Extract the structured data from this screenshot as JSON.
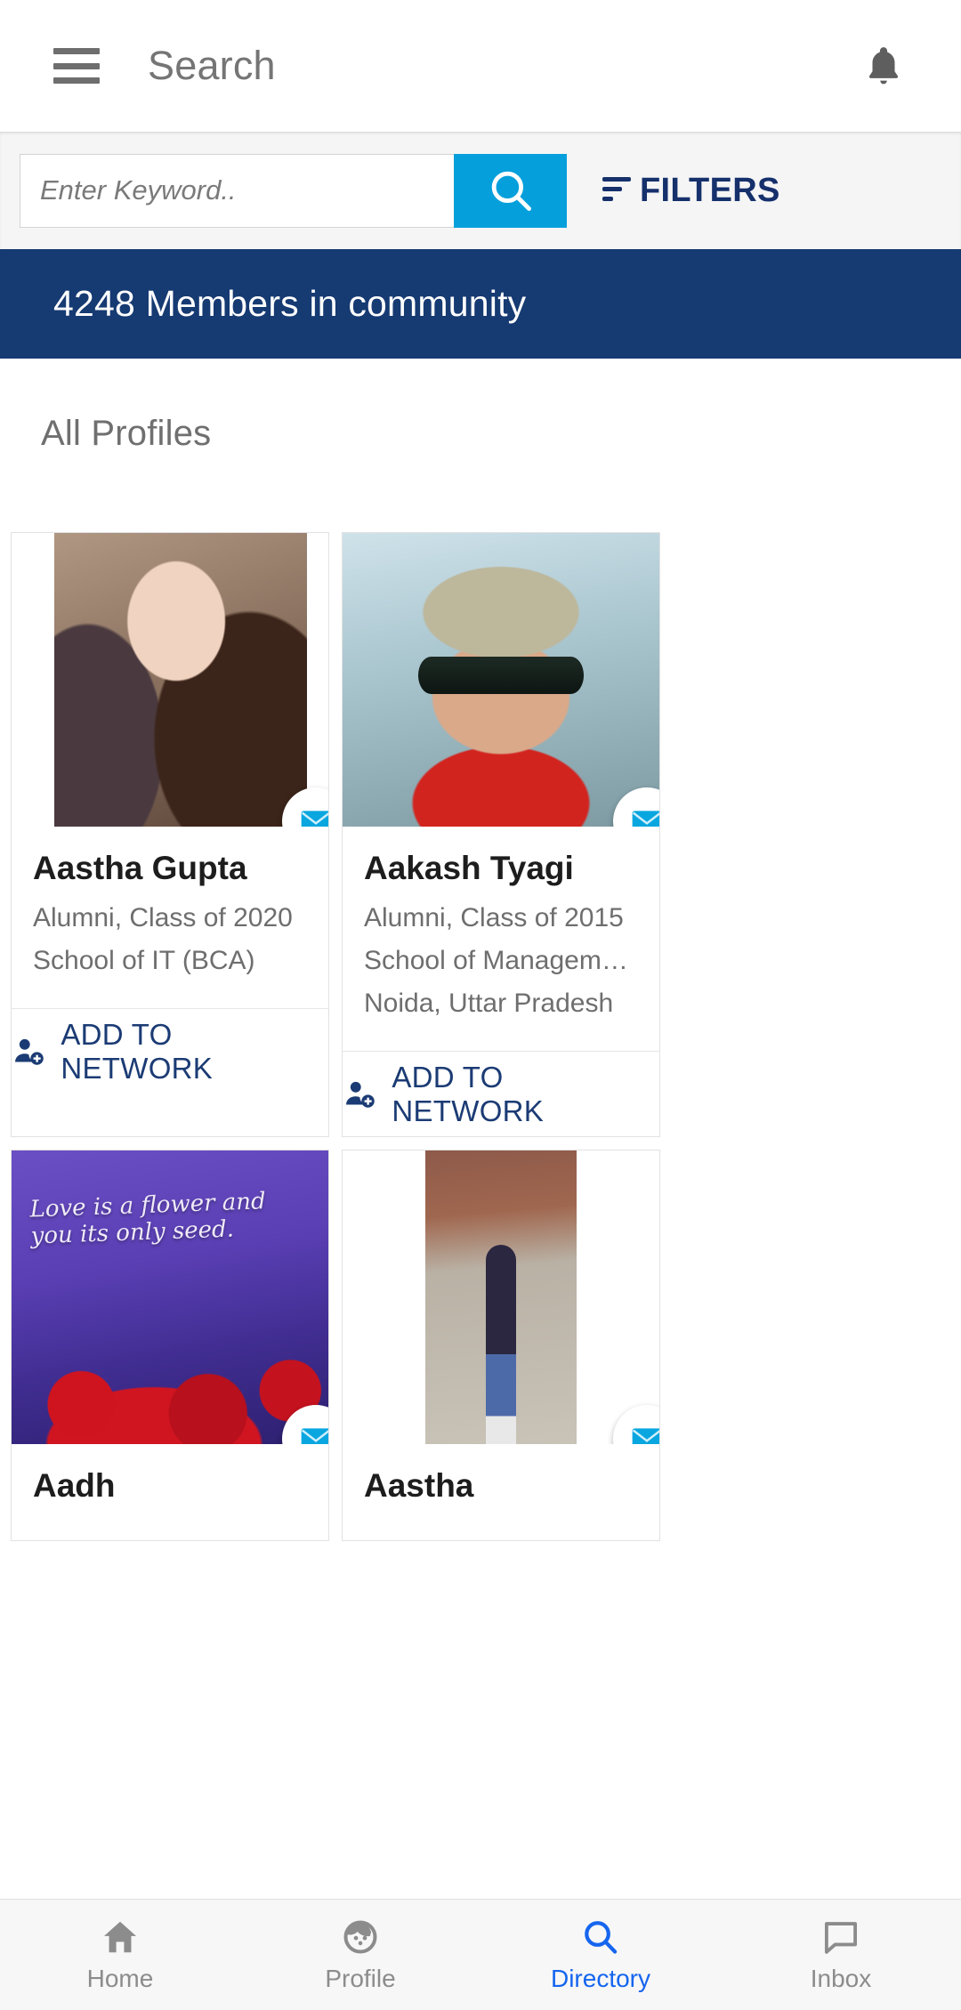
{
  "appbar": {
    "menu_icon": "hamburger-menu-icon",
    "title": "Search",
    "notification_icon": "bell-icon"
  },
  "search": {
    "placeholder": "Enter Keyword..",
    "value": "",
    "search_icon": "magnifier-icon",
    "filters_label": "FILTERS",
    "filters_icon": "filter-lines-icon",
    "button_color": "#05a0dc"
  },
  "banner": {
    "text": "4248 Members in community",
    "background": "#163a72",
    "count": 4248
  },
  "main": {
    "section_title": "All Profiles",
    "add_to_network_label": "ADD TO NETWORK",
    "add_icon": "person-add-icon",
    "message_icon": "envelope-icon",
    "accent_navy": "#1b3b74",
    "accent_cyan": "#05a0dc",
    "profiles": [
      {
        "name": "Aastha Gupta",
        "line1": "Alumni, Class of 2020",
        "line2": "School of IT (BCA)",
        "line3": "",
        "photo": "woman-selfie-photo",
        "action": "ADD TO NETWORK"
      },
      {
        "name": "Aakash Tyagi",
        "line1": "Alumni, Class of 2015",
        "line2": "School of Management Stu…",
        "line3": "Noida, Uttar Pradesh",
        "photo": "man-beanie-sunglasses-photo",
        "action": "ADD TO NETWORK"
      },
      {
        "name": "Aadh",
        "line1": "",
        "line2": "",
        "line3": "",
        "photo": "roses-quote-photo",
        "photo_caption": "Love is a flower and you its only seed.",
        "action": ""
      },
      {
        "name": "Aastha",
        "line1": "",
        "line2": "",
        "line3": "",
        "photo": "woman-standing-outdoors-photo",
        "action": ""
      }
    ]
  },
  "bottom_nav": {
    "active": "Directory",
    "items": [
      {
        "label": "Home",
        "icon": "home-icon",
        "active": false
      },
      {
        "label": "Profile",
        "icon": "person-face-icon",
        "active": false
      },
      {
        "label": "Directory",
        "icon": "search-icon",
        "active": true
      },
      {
        "label": "Inbox",
        "icon": "chat-bubble-icon",
        "active": false
      }
    ],
    "active_color": "#1565ef",
    "inactive_color": "#8c8c8c"
  }
}
